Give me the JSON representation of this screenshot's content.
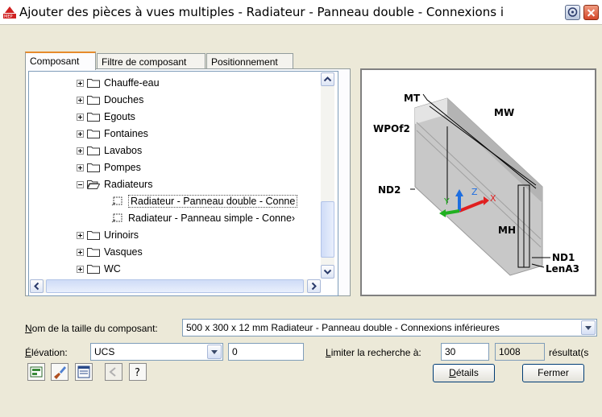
{
  "window": {
    "title": "Ajouter des pièces à vues multiples - Radiateur - Panneau double - Connexions i"
  },
  "tabs": [
    {
      "label": "Composant",
      "active": true
    },
    {
      "label": "Filtre de composant",
      "active": false
    },
    {
      "label": "Positionnement",
      "active": false
    }
  ],
  "tree": {
    "items": [
      {
        "label": "Chauffe-eau",
        "type": "folder",
        "expanded": false
      },
      {
        "label": "Douches",
        "type": "folder",
        "expanded": false
      },
      {
        "label": "Egouts",
        "type": "folder",
        "expanded": false
      },
      {
        "label": "Fontaines",
        "type": "folder",
        "expanded": false
      },
      {
        "label": "Lavabos",
        "type": "folder",
        "expanded": false
      },
      {
        "label": "Pompes",
        "type": "folder",
        "expanded": false
      },
      {
        "label": "Radiateurs",
        "type": "folder",
        "expanded": true
      },
      {
        "label": "Radiateur - Panneau double - Conne",
        "type": "part",
        "selected": true
      },
      {
        "label": "Radiateur - Panneau simple - Conne›",
        "type": "part",
        "selected": false
      },
      {
        "label": "Urinoirs",
        "type": "folder",
        "expanded": false
      },
      {
        "label": "Vasques",
        "type": "folder",
        "expanded": false
      },
      {
        "label": "WC",
        "type": "folder",
        "expanded": false
      }
    ]
  },
  "preview": {
    "labels": {
      "mt": "MT",
      "mw": "MW",
      "wpof2": "WPOf2",
      "nd2": "ND2",
      "mh": "MH",
      "nd1": "ND1",
      "lena3": "LenA3",
      "axis_z": "Z",
      "axis_x": "X",
      "axis_y": "Y"
    },
    "colors": {
      "panel": "#c8c8c8",
      "axis_x": "#e02020",
      "axis_y": "#20b020",
      "axis_z": "#1e6ee0"
    }
  },
  "form": {
    "size_label_prefix": "N",
    "size_label_rest": "om de la taille du composant:",
    "size_value": "500 x 300 x 12 mm Radiateur - Panneau double - Connexions inférieures",
    "elevation_label_prefix": "É",
    "elevation_label_rest": "lévation:",
    "elevation_select": "UCS",
    "elevation_value": "0",
    "limit_label_prefix": "L",
    "limit_label_rest": "imiter la recherche à:",
    "limit_value": "30",
    "result_count": "1008",
    "result_label": "résultat(s"
  },
  "buttons": {
    "details_prefix": "D",
    "details_rest": "étails",
    "close": "Fermer"
  },
  "toolbar_icons": [
    "catalog-icon",
    "paintbrush-icon",
    "properties-icon",
    "back-icon",
    "help-icon"
  ]
}
